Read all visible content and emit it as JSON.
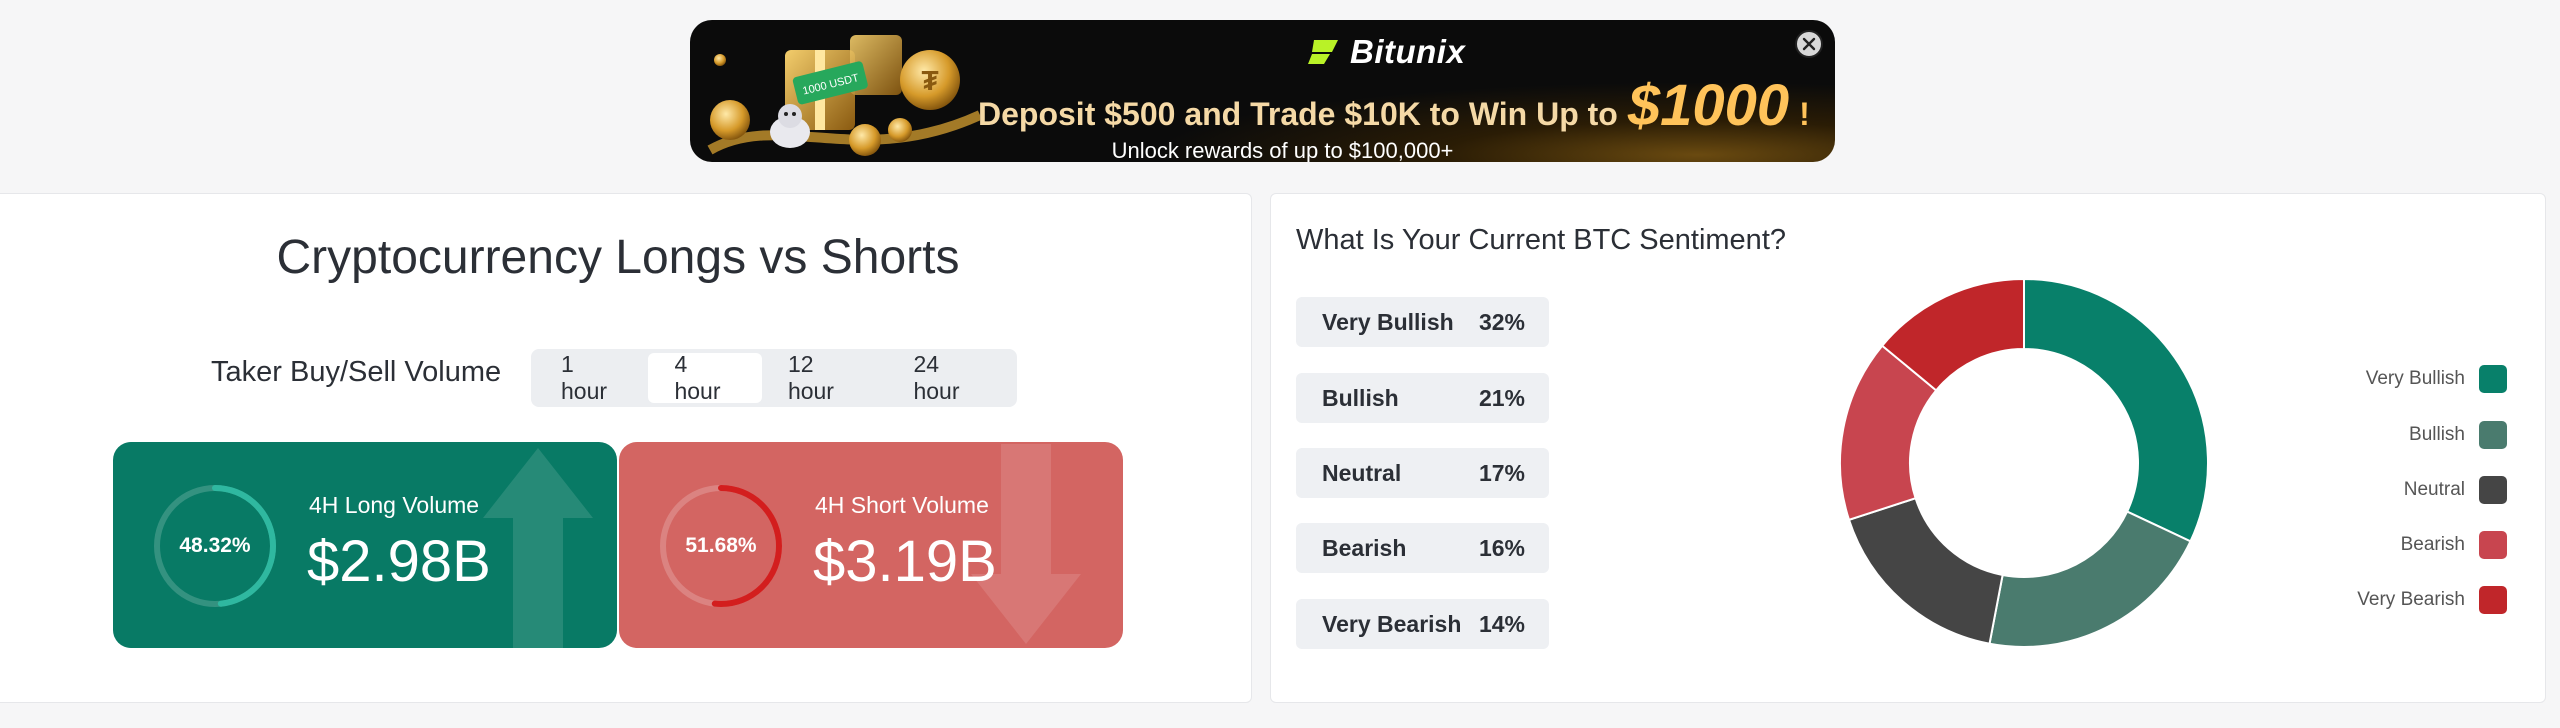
{
  "banner": {
    "brand": "Bitunix",
    "art_badge": "1000 USDT",
    "headline": "Deposit $500 and Trade $10K to Win Up to",
    "amount": "$1000",
    "bang": "!",
    "subline": "Unlock rewards of up to $100,000+",
    "close_icon": "close-icon"
  },
  "longs_shorts": {
    "title": "Cryptocurrency Longs vs Shorts",
    "taker_label": "Taker Buy/Sell Volume",
    "timeframes": [
      "1 hour",
      "4 hour",
      "12 hour",
      "24 hour"
    ],
    "active_timeframe": "4 hour",
    "long": {
      "label": "4H Long Volume",
      "value": "$2.98B",
      "percent_text": "48.32%",
      "percent": 48.32,
      "color": "#087a65",
      "icon": "arrow-up-icon"
    },
    "short": {
      "label": "4H Short Volume",
      "value": "$3.19B",
      "percent_text": "51.68%",
      "percent": 51.68,
      "color": "#d36562",
      "icon": "arrow-down-icon"
    }
  },
  "sentiment": {
    "title": "What Is Your Current BTC Sentiment?",
    "items": [
      {
        "label": "Very Bullish",
        "percent": "32%"
      },
      {
        "label": "Bullish",
        "percent": "21%"
      },
      {
        "label": "Neutral",
        "percent": "17%"
      },
      {
        "label": "Bearish",
        "percent": "16%"
      },
      {
        "label": "Very Bearish",
        "percent": "14%"
      }
    ]
  },
  "chart_data": {
    "type": "pie",
    "donut": true,
    "categories": [
      "Very Bullish",
      "Bullish",
      "Neutral",
      "Bearish",
      "Very Bearish"
    ],
    "values": [
      32,
      21,
      17,
      16,
      14
    ],
    "colors": [
      "#08806a",
      "#4a7b6e",
      "#454545",
      "#c8454f",
      "#c0262a"
    ],
    "legend_position": "right"
  }
}
